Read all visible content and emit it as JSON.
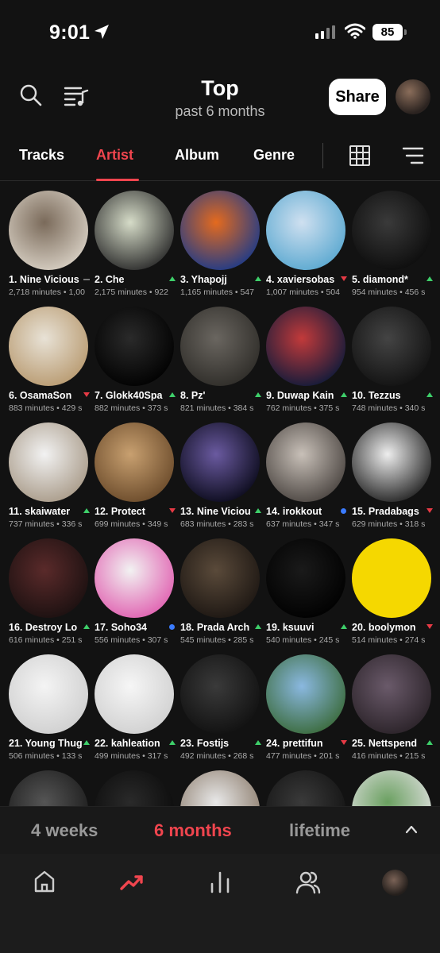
{
  "status_bar": {
    "time": "9:01",
    "battery": "85"
  },
  "header": {
    "title": "Top",
    "subtitle": "past 6 months",
    "share_label": "Share"
  },
  "tabs": [
    {
      "label": "Tracks",
      "active": false
    },
    {
      "label": "Artist",
      "active": true
    },
    {
      "label": "Album",
      "active": false
    },
    {
      "label": "Genre",
      "active": false
    }
  ],
  "artists": [
    {
      "name": "1. Nine Vicious",
      "stats": "2,718 minutes • 1,00",
      "trend": "same",
      "colors": [
        "#7a6a5a",
        "#d8d0c4"
      ]
    },
    {
      "name": "2. Che",
      "stats": "2,175 minutes • 922",
      "trend": "up",
      "colors": [
        "#d6dcc8",
        "#2a2a2a"
      ]
    },
    {
      "name": "3. Yhapojj",
      "stats": "1,165 minutes • 547",
      "trend": "up",
      "colors": [
        "#e46a1e",
        "#1b3a8a"
      ]
    },
    {
      "name": "4. xaviersobas",
      "stats": "1,007 minutes • 504",
      "trend": "down",
      "colors": [
        "#cfe0f0",
        "#5aa8d0"
      ]
    },
    {
      "name": "5. diamond*",
      "stats": "954 minutes • 456 s",
      "trend": "up",
      "colors": [
        "#3a3a3a",
        "#0c0c0c"
      ]
    },
    {
      "name": "6. OsamaSon",
      "stats": "883 minutes • 429 s",
      "trend": "down",
      "colors": [
        "#e8e2d6",
        "#b89a70"
      ]
    },
    {
      "name": "7. Glokk40Spa",
      "stats": "882 minutes • 373 s",
      "trend": "up",
      "colors": [
        "#2a2a2a",
        "#000000"
      ]
    },
    {
      "name": "8. Pz'",
      "stats": "821 minutes • 384 s",
      "trend": "up",
      "colors": [
        "#6a6660",
        "#2e2c28"
      ]
    },
    {
      "name": "9. Duwap Kain",
      "stats": "762 minutes • 375 s",
      "trend": "up",
      "colors": [
        "#c23a3a",
        "#0e1a3a"
      ]
    },
    {
      "name": "10. Tezzus",
      "stats": "748 minutes • 340 s",
      "trend": "up",
      "colors": [
        "#444444",
        "#111111"
      ]
    },
    {
      "name": "11. skaiwater",
      "stats": "737 minutes • 336 s",
      "trend": "up",
      "colors": [
        "#f2f2f2",
        "#a89a88"
      ]
    },
    {
      "name": "12. Protect",
      "stats": "699 minutes • 349 s",
      "trend": "down",
      "colors": [
        "#c8a070",
        "#6a4a2a"
      ]
    },
    {
      "name": "13. Nine Viciou",
      "stats": "683 minutes • 283 s",
      "trend": "up",
      "colors": [
        "#6a5aa0",
        "#0a0a1a"
      ]
    },
    {
      "name": "14. irokkout",
      "stats": "637 minutes • 347 s",
      "trend": "new",
      "colors": [
        "#c8c0b8",
        "#4a4440"
      ]
    },
    {
      "name": "15. Pradabags",
      "stats": "629 minutes • 318 s",
      "trend": "down",
      "colors": [
        "#eeeeee",
        "#222222"
      ]
    },
    {
      "name": "16. Destroy Lo",
      "stats": "616 minutes • 251 s",
      "trend": "up",
      "colors": [
        "#5a2a2a",
        "#1a1010"
      ]
    },
    {
      "name": "17. Soho34",
      "stats": "556 minutes • 307 s",
      "trend": "new",
      "colors": [
        "#f2f2f2",
        "#e060b0"
      ]
    },
    {
      "name": "18. Prada Arch",
      "stats": "545 minutes • 285 s",
      "trend": "up",
      "colors": [
        "#5a4a3a",
        "#1c1612"
      ]
    },
    {
      "name": "19. ksuuvi",
      "stats": "540 minutes • 245 s",
      "trend": "up",
      "colors": [
        "#1a1a1a",
        "#000000"
      ]
    },
    {
      "name": "20. boolymon",
      "stats": "514 minutes • 274 s",
      "trend": "down",
      "colors": [
        "#f5d800",
        "#f5d800"
      ]
    },
    {
      "name": "21. Young Thug",
      "stats": "506 minutes • 133 s",
      "trend": "up",
      "colors": [
        "#f4f4f4",
        "#cfcfcf"
      ]
    },
    {
      "name": "22. kahleation",
      "stats": "499 minutes • 317 s",
      "trend": "up",
      "colors": [
        "#f6f6f6",
        "#d0d0d0"
      ]
    },
    {
      "name": "23. Fostijs",
      "stats": "492 minutes • 268 s",
      "trend": "up",
      "colors": [
        "#3a3a3a",
        "#101010"
      ]
    },
    {
      "name": "24. prettifun",
      "stats": "477 minutes • 201 s",
      "trend": "down",
      "colors": [
        "#8ab8e0",
        "#3a6a3a"
      ]
    },
    {
      "name": "25. Nettspend",
      "stats": "416 minutes • 215 s",
      "trend": "up",
      "colors": [
        "#6a5a6a",
        "#2a2228"
      ]
    },
    {
      "name": "",
      "stats": "",
      "trend": "",
      "colors": [
        "#555555",
        "#1a1a1a"
      ]
    },
    {
      "name": "",
      "stats": "",
      "trend": "",
      "colors": [
        "#2a2a2a",
        "#0a0a0a"
      ]
    },
    {
      "name": "",
      "stats": "",
      "trend": "",
      "colors": [
        "#e8e8e8",
        "#8a7a6a"
      ]
    },
    {
      "name": "",
      "stats": "",
      "trend": "",
      "colors": [
        "#3a3a3a",
        "#121212"
      ]
    },
    {
      "name": "",
      "stats": "",
      "trend": "",
      "colors": [
        "#6aa060",
        "#e0e0e0"
      ]
    }
  ],
  "period": [
    {
      "label": "4 weeks",
      "active": false
    },
    {
      "label": "6 months",
      "active": true
    },
    {
      "label": "lifetime",
      "active": false
    }
  ],
  "nav": [
    "home-icon",
    "trending-icon",
    "stats-icon",
    "friends-icon",
    "profile-avatar"
  ],
  "accent": "#f0454e"
}
